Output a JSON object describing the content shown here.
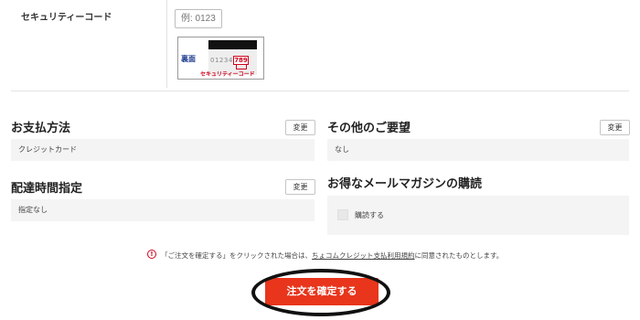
{
  "security_code": {
    "label": "セキュリティーコード",
    "placeholder": "例: 0123",
    "card": {
      "back_label": "裏面",
      "number": "012345",
      "cvc": "789",
      "cvc_label": "セキュリティーコード"
    }
  },
  "payment": {
    "title": "お支払方法",
    "change_label": "変更",
    "value": "クレジットカード"
  },
  "other_requests": {
    "title": "その他のご要望",
    "change_label": "変更",
    "value": "なし"
  },
  "delivery_time": {
    "title": "配達時間指定",
    "change_label": "変更",
    "value": "指定なし"
  },
  "newsletter": {
    "title": "お得なメールマガジンの購読",
    "checkbox_label": "購読する",
    "checked": false
  },
  "notice": {
    "icon": "!",
    "text_before": "「ご注文を確定する」をクリックされた場合は、",
    "link": "ちょコムクレジット支払利用規約",
    "text_after": "に同意されたものとします。"
  },
  "submit": {
    "label": "注文を確定する",
    "color": "#e8351c"
  }
}
